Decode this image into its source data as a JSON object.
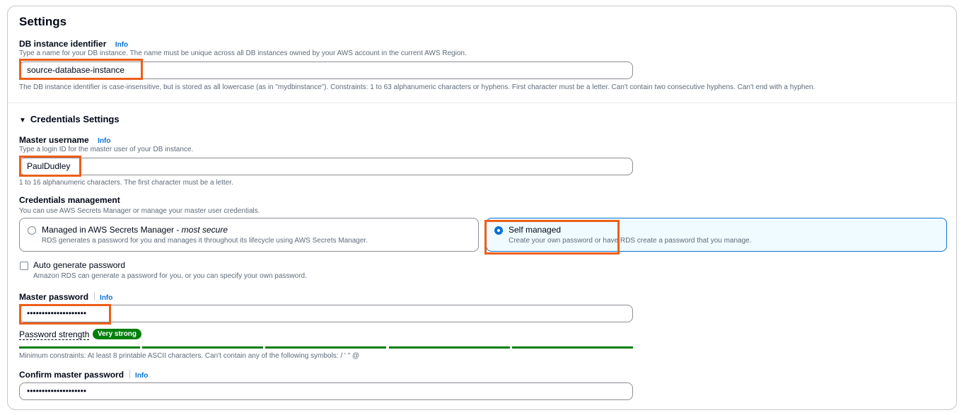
{
  "settings": {
    "title": "Settings",
    "db_identifier": {
      "label": "DB instance identifier",
      "info": "Info",
      "description": "Type a name for your DB instance. The name must be unique across all DB instances owned by your AWS account in the current AWS Region.",
      "value": "source-database-instance",
      "constraint": "The DB instance identifier is case-insensitive, but is stored as all lowercase (as in \"mydbinstance\"). Constraints: 1 to 63 alphanumeric characters or hyphens. First character must be a letter. Can't contain two consecutive hyphens. Can't end with a hyphen."
    }
  },
  "credentials": {
    "section_title": "Credentials Settings",
    "master_username": {
      "label": "Master username",
      "info": "Info",
      "description": "Type a login ID for the master user of your DB instance.",
      "value": "PaulDudley",
      "constraint": "1 to 16 alphanumeric characters. The first character must be a letter."
    },
    "management": {
      "label": "Credentials management",
      "description": "You can use AWS Secrets Manager or manage your master user credentials.",
      "options": [
        {
          "title": "Managed in AWS Secrets Manager - ",
          "title_em": "most secure",
          "description": "RDS generates a password for you and manages it throughout its lifecycle using AWS Secrets Manager.",
          "selected": false
        },
        {
          "title": "Self managed",
          "title_em": "",
          "description": "Create your own password or have RDS create a password that you manage.",
          "selected": true
        }
      ]
    },
    "auto_generate": {
      "label": "Auto generate password",
      "description": "Amazon RDS can generate a password for you, or you can specify your own password.",
      "checked": false
    },
    "master_password": {
      "label": "Master password",
      "info": "Info",
      "value": "••••••••••••••••••••",
      "strength_label": "Password strength",
      "strength_value": "Very strong",
      "strength_level": 5,
      "constraint": "Minimum constraints: At least 8 printable ASCII characters. Can't contain any of the following symbols: / ' \" @"
    },
    "confirm_password": {
      "label": "Confirm master password",
      "info": "Info",
      "value": "••••••••••••••••••••"
    }
  },
  "colors": {
    "highlight": "#ec5f1a",
    "accent": "#0972d3",
    "success": "#037f0c"
  }
}
